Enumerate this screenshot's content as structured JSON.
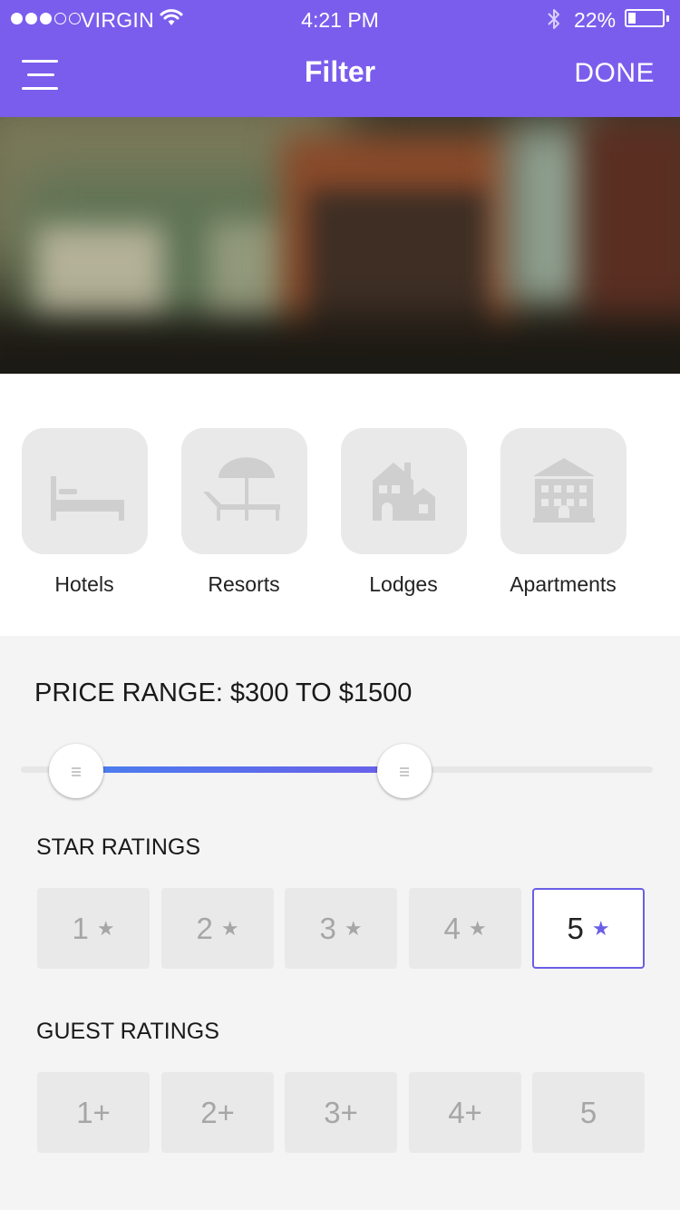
{
  "status_bar": {
    "carrier": "VIRGIN",
    "signal_bars": 3,
    "signal_max": 5,
    "time": "4:21 PM",
    "battery_pct": "22%",
    "battery_level": 0.22
  },
  "nav": {
    "menu_icon": "hamburger-menu-icon",
    "title": "Filter",
    "done_label": "DONE"
  },
  "colors": {
    "accent": "#7b5ded",
    "selected_border": "#6a5fe6",
    "slider_fill_start": "#4a7fef",
    "slider_fill_end": "#6b5ee9",
    "tile_bg": "#e9e9e9"
  },
  "categories": [
    {
      "label": "Hotels",
      "icon": "bed-icon"
    },
    {
      "label": "Resorts",
      "icon": "beach-umbrella-icon"
    },
    {
      "label": "Lodges",
      "icon": "lodge-house-icon"
    },
    {
      "label": "Apartments",
      "icon": "apartment-building-icon"
    }
  ],
  "price": {
    "label": "PRICE RANGE: $300 TO $1500",
    "range_fraction": [
      0.088,
      0.607
    ]
  },
  "star_ratings": {
    "label": "STAR RATINGS",
    "options": [
      "1",
      "2",
      "3",
      "4",
      "5"
    ],
    "selected": "5"
  },
  "guest_ratings": {
    "label": "GUEST RATINGS",
    "options": [
      "1+",
      "2+",
      "3+",
      "4+",
      "5"
    ]
  }
}
